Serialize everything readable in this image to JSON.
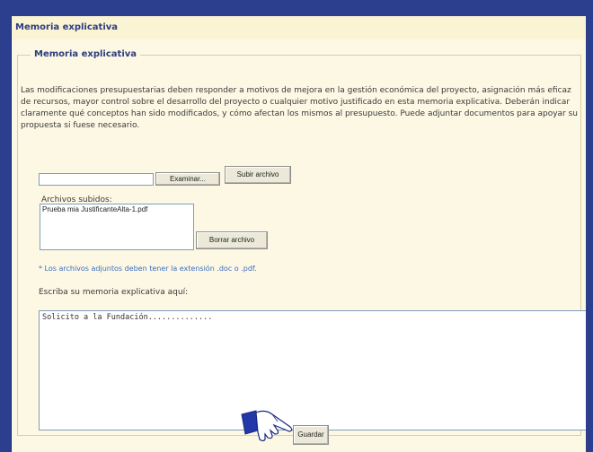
{
  "header": {
    "title": "Memoria explicativa"
  },
  "section": {
    "legend": "Memoria explicativa",
    "description": "Las modificaciones presupuestarias deben responder a motivos de mejora en la gestión económica del proyecto, asignación más eficaz de recursos, mayor control sobre el desarrollo del proyecto o cualquier motivo justificado en esta memoria explicativa. Deberán indicar claramente qué conceptos han sido modificados, y cómo afectan los mismos al presupuesto. Puede adjuntar documentos para apoyar su propuesta si fuese necesario."
  },
  "upload": {
    "file_value": "",
    "browse_label": "Examinar...",
    "upload_label": "Subir archivo",
    "uploaded_label": "Archivos subidos:",
    "files": [
      "Prueba mia JustificanteAlta-1.pdf"
    ],
    "delete_label": "Borrar archivo",
    "note": "* Los archivos adjuntos deben tener la extensión .doc o .pdf."
  },
  "memo": {
    "label": "Escriba su memoria explicativa aquí:",
    "value": "Solicito a la Fundación.............."
  },
  "actions": {
    "save_label": "Guardar"
  },
  "icons": {
    "pointer": "pointing-hand-icon"
  },
  "colors": {
    "frame": "#2c3f8f",
    "header_bg": "#fbf4d4",
    "title": "#2d3c7e",
    "note": "#3c6cbf"
  }
}
